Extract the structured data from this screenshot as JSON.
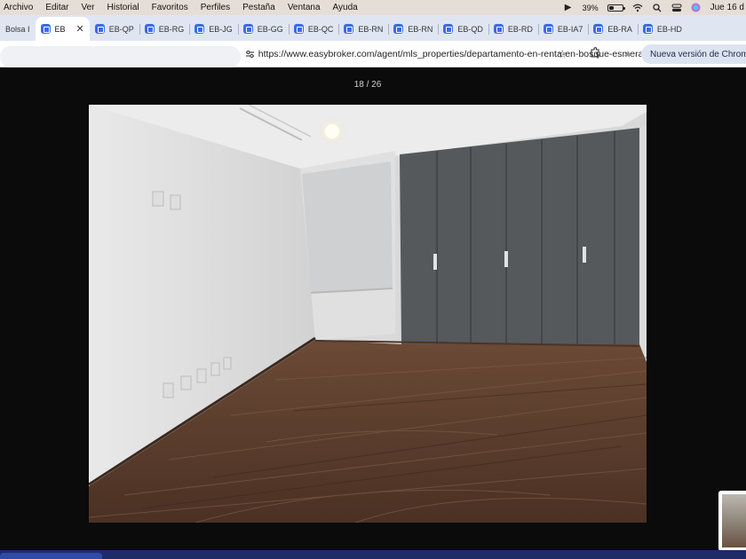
{
  "menubar": {
    "items": [
      "Archivo",
      "Editar",
      "Ver",
      "Historial",
      "Favoritos",
      "Perfiles",
      "Pestaña",
      "Ventana",
      "Ayuda"
    ],
    "battery_percent": "39%",
    "battery_level": 0.39,
    "date": "Jue 16 d"
  },
  "tabs": [
    {
      "label": "Bolsa I",
      "favicon": false,
      "active": false
    },
    {
      "label": "EB",
      "favicon": true,
      "active": true
    },
    {
      "label": "EB-QP",
      "favicon": true,
      "active": false
    },
    {
      "label": "EB-RG",
      "favicon": true,
      "active": false
    },
    {
      "label": "EB-JG",
      "favicon": true,
      "active": false
    },
    {
      "label": "EB-GG",
      "favicon": true,
      "active": false
    },
    {
      "label": "EB-QC",
      "favicon": true,
      "active": false
    },
    {
      "label": "EB-RN",
      "favicon": true,
      "active": false
    },
    {
      "label": "EB-RN",
      "favicon": true,
      "active": false
    },
    {
      "label": "EB-QD",
      "favicon": true,
      "active": false
    },
    {
      "label": "EB-RD",
      "favicon": true,
      "active": false
    },
    {
      "label": "EB-IA7",
      "favicon": true,
      "active": false
    },
    {
      "label": "EB-RA",
      "favicon": true,
      "active": false
    },
    {
      "label": "EB-HD",
      "favicon": true,
      "active": false
    }
  ],
  "address_bar": {
    "url": "https://www.easybroker.com/agent/mls_properties/departamento-en-renta-en-bosque-esmeralda-bosques-de-atizapan",
    "update_button": "Nueva versión de Chrome"
  },
  "viewer": {
    "counter": "18 / 26"
  },
  "colors": {
    "viewer_bg": "#0b0b0b",
    "tabstrip_bg": "#dfe6f2",
    "favicon": "#3a6be8",
    "closet": "#55595c",
    "floor": "#5d3f2e"
  },
  "icons": [
    "apple-menu",
    "play-icon",
    "wifi-icon",
    "search-icon",
    "control-center-icon",
    "siri-icon",
    "site-info-icon",
    "star-icon",
    "extensions-icon",
    "close-icon"
  ]
}
